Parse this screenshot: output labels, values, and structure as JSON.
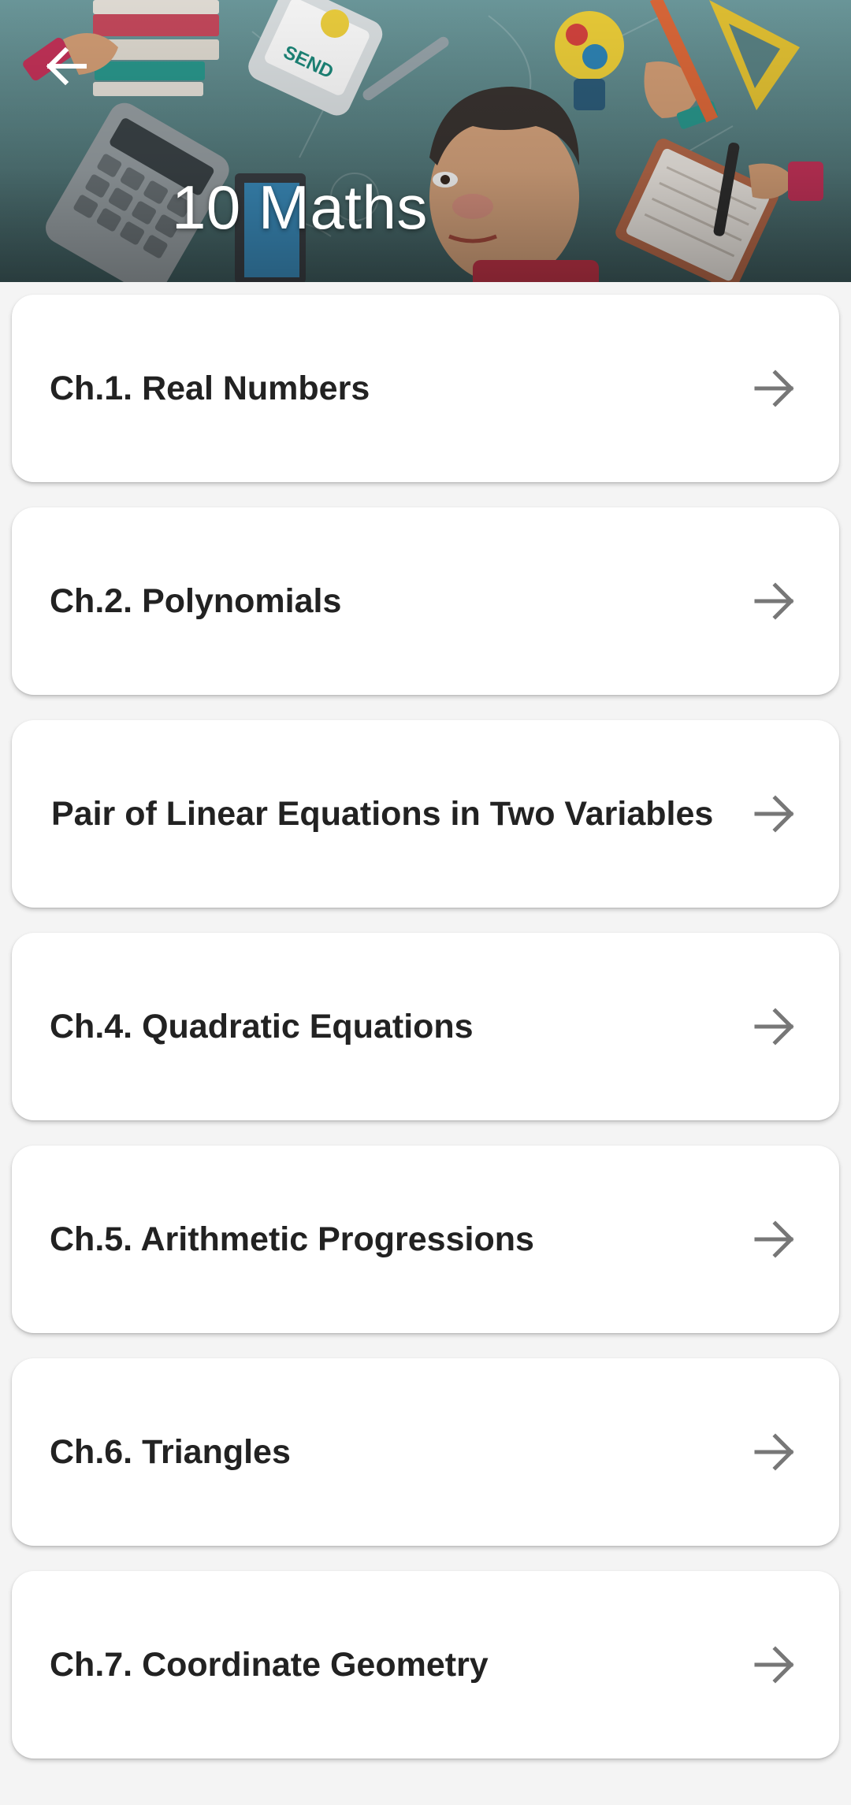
{
  "header": {
    "title": "10 Maths",
    "back_icon": "arrow-left-icon",
    "background_color": "#5b8486"
  },
  "chapters": [
    {
      "label": "Ch.1. Real Numbers",
      "icon": "arrow-right-icon"
    },
    {
      "label": "Ch.2. Polynomials",
      "icon": "arrow-right-icon"
    },
    {
      "label": "Pair of Linear Equations in Two Variables",
      "icon": "arrow-right-icon"
    },
    {
      "label": "Ch.4. Quadratic Equations",
      "icon": "arrow-right-icon"
    },
    {
      "label": "Ch.5. Arithmetic Progressions",
      "icon": "arrow-right-icon"
    },
    {
      "label": "Ch.6. Triangles",
      "icon": "arrow-right-icon"
    },
    {
      "label": "Ch.7. Coordinate Geometry",
      "icon": "arrow-right-icon"
    }
  ],
  "colors": {
    "card_background": "#ffffff",
    "page_background": "#f4f4f4",
    "label_text": "#222222",
    "arrow": "#777777"
  }
}
